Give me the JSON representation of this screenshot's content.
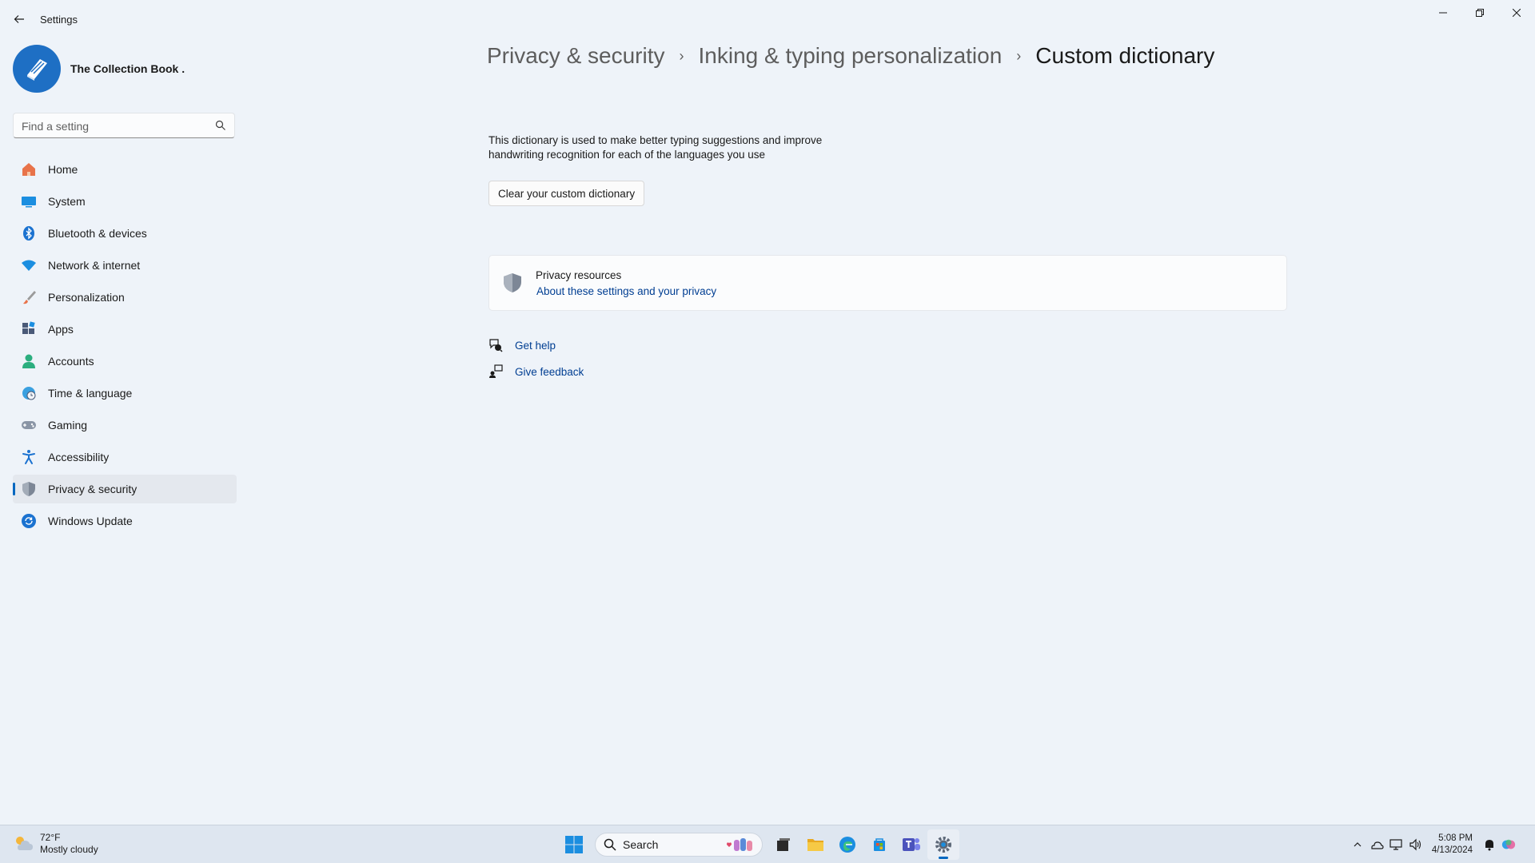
{
  "window": {
    "title": "Settings",
    "controls": [
      "minimize",
      "restore",
      "close"
    ]
  },
  "profile": {
    "name": "The Collection Book ."
  },
  "search": {
    "placeholder": "Find a setting"
  },
  "sidebar": {
    "items": [
      {
        "label": "Home",
        "icon": "home-icon"
      },
      {
        "label": "System",
        "icon": "monitor-icon"
      },
      {
        "label": "Bluetooth & devices",
        "icon": "bluetooth-icon"
      },
      {
        "label": "Network & internet",
        "icon": "wifi-icon"
      },
      {
        "label": "Personalization",
        "icon": "brush-icon"
      },
      {
        "label": "Apps",
        "icon": "apps-icon"
      },
      {
        "label": "Accounts",
        "icon": "person-icon"
      },
      {
        "label": "Time & language",
        "icon": "globe-clock-icon"
      },
      {
        "label": "Gaming",
        "icon": "gamepad-icon"
      },
      {
        "label": "Accessibility",
        "icon": "accessibility-icon"
      },
      {
        "label": "Privacy & security",
        "icon": "shield-icon",
        "active": true
      },
      {
        "label": "Windows Update",
        "icon": "refresh-icon"
      }
    ]
  },
  "breadcrumb": {
    "items": [
      "Privacy & security",
      "Inking & typing personalization",
      "Custom dictionary"
    ],
    "separator": "›"
  },
  "main": {
    "description_line1": "This dictionary is used to make better typing suggestions and improve",
    "description_line2": "handwriting recognition for each of the languages you use",
    "clear_button": "Clear your custom dictionary",
    "privacy_card": {
      "title": "Privacy resources",
      "link": "About these settings and your privacy"
    },
    "help_links": [
      {
        "label": "Get help",
        "icon": "help-chat-icon"
      },
      {
        "label": "Give feedback",
        "icon": "feedback-icon"
      }
    ]
  },
  "taskbar": {
    "weather": {
      "temp": "72°F",
      "condition": "Mostly cloudy"
    },
    "search_label": "Search",
    "pinned": [
      "start-icon",
      "task-view-icon",
      "file-explorer-icon",
      "edge-icon",
      "store-icon",
      "teams-icon",
      "settings-icon"
    ],
    "clock": {
      "time": "5:08 PM",
      "date": "4/13/2024"
    }
  },
  "colors": {
    "accent": "#0067c0",
    "link": "#003e92",
    "background": "#eef3f9"
  }
}
